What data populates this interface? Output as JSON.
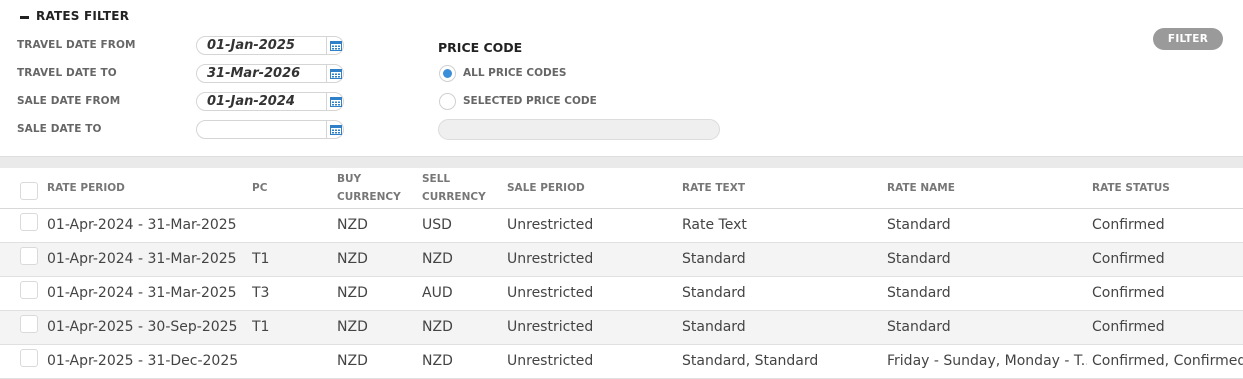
{
  "filter": {
    "title": "RATES FILTER",
    "travel_date_from": {
      "label": "TRAVEL DATE FROM",
      "value": "01-Jan-2025"
    },
    "travel_date_to": {
      "label": "TRAVEL DATE TO",
      "value": "31-Mar-2026"
    },
    "sale_date_from": {
      "label": "SALE DATE FROM",
      "value": "01-Jan-2024"
    },
    "sale_date_to": {
      "label": "SALE DATE TO",
      "value": ""
    },
    "price_code": {
      "title": "PRICE CODE",
      "options": [
        {
          "label": "ALL PRICE CODES",
          "selected": true
        },
        {
          "label": "SELECTED PRICE CODE",
          "selected": false
        }
      ],
      "input_value": ""
    },
    "filter_button": "FILTER",
    "icons": {
      "collapse": "minus-icon",
      "date_picker": "calendar-icon"
    }
  },
  "grid": {
    "headers": {
      "rate_period": "RATE PERIOD",
      "pc": "PC",
      "buy_currency_1": "BUY",
      "buy_currency_2": "CURRENCY",
      "sell_currency_1": "SELL",
      "sell_currency_2": "CURRENCY",
      "sale_period": "SALE PERIOD",
      "rate_text": "RATE TEXT",
      "rate_name": "RATE NAME",
      "rate_status": "RATE STATUS"
    },
    "rows": [
      {
        "rate_period": "01-Apr-2024 - 31-Mar-2025",
        "pc": "",
        "buy": "NZD",
        "sell": "USD",
        "sale_period": "Unrestricted",
        "rate_text": "Rate Text",
        "rate_name": "Standard",
        "rate_status": "Confirmed"
      },
      {
        "rate_period": "01-Apr-2024 - 31-Mar-2025",
        "pc": "T1",
        "buy": "NZD",
        "sell": "NZD",
        "sale_period": "Unrestricted",
        "rate_text": "Standard",
        "rate_name": "Standard",
        "rate_status": "Confirmed"
      },
      {
        "rate_period": "01-Apr-2024 - 31-Mar-2025",
        "pc": "T3",
        "buy": "NZD",
        "sell": "AUD",
        "sale_period": "Unrestricted",
        "rate_text": "Standard",
        "rate_name": "Standard",
        "rate_status": "Confirmed"
      },
      {
        "rate_period": "01-Apr-2025 - 30-Sep-2025",
        "pc": "T1",
        "buy": "NZD",
        "sell": "NZD",
        "sale_period": "Unrestricted",
        "rate_text": "Standard",
        "rate_name": "Standard",
        "rate_status": "Confirmed"
      },
      {
        "rate_period": "01-Apr-2025 - 31-Dec-2025",
        "pc": "",
        "buy": "NZD",
        "sell": "NZD",
        "sale_period": "Unrestricted",
        "rate_text": "Standard, Standard",
        "rate_name": "Friday - Sunday, Monday - T...",
        "rate_status": "Confirmed, Confirmed"
      }
    ]
  },
  "colors": {
    "accent": "#3a8fd8",
    "button": "#9a9a9a",
    "alt_row": "#f4f4f4"
  }
}
